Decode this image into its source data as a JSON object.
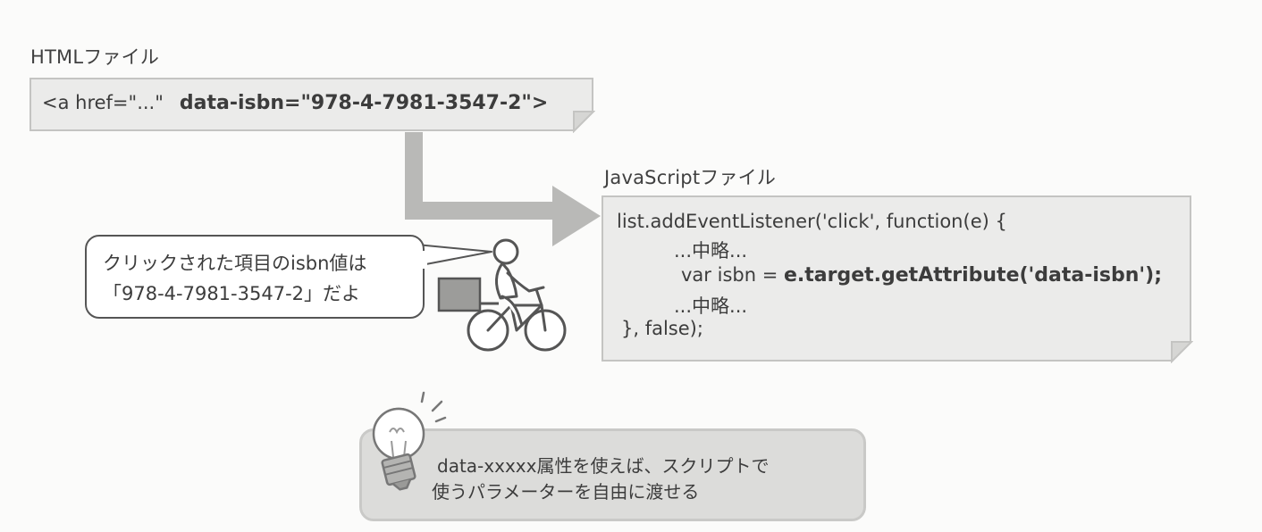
{
  "html_file": {
    "title": "HTMLファイル",
    "code_prefix": "<a href=\"...\"",
    "code_attr": "data-isbn=\"978-4-7981-3547-2\">"
  },
  "js_file": {
    "title": "JavaScriptファイル",
    "lines": [
      "list.addEventListener('click', function(e) {",
      "...中略...",
      "var isbn = ",
      "e.target.getAttribute('data-isbn');",
      "...中略...",
      "}, false);"
    ]
  },
  "speech": {
    "line1": "クリックされた項目のisbn値は",
    "line2": "「978-4-7981-3547-2」だよ"
  },
  "tip": {
    "line1": "data-xxxxx属性を使えば、スクリプトで",
    "line2": "使うパラメーターを自由に渡せる"
  }
}
